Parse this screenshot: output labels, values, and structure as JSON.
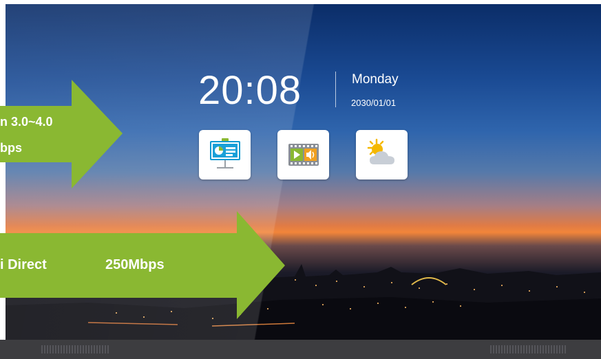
{
  "clock": {
    "time": "20:08",
    "day": "Monday",
    "date": "2030/01/01"
  },
  "apps": [
    {
      "icon": "presentation-icon"
    },
    {
      "icon": "media-player-icon"
    },
    {
      "icon": "weather-icon"
    }
  ],
  "annotations": {
    "upper_arrow": {
      "line1": "n 3.0~4.0",
      "line2": "bps"
    },
    "lower_arrow": {
      "label": "i Direct",
      "speed": "250Mbps"
    }
  },
  "colors": {
    "arrow": "#8ab832",
    "screen_top": "#0b2d68",
    "horizon": "#f2853a",
    "bezel": "#3d3d40"
  }
}
